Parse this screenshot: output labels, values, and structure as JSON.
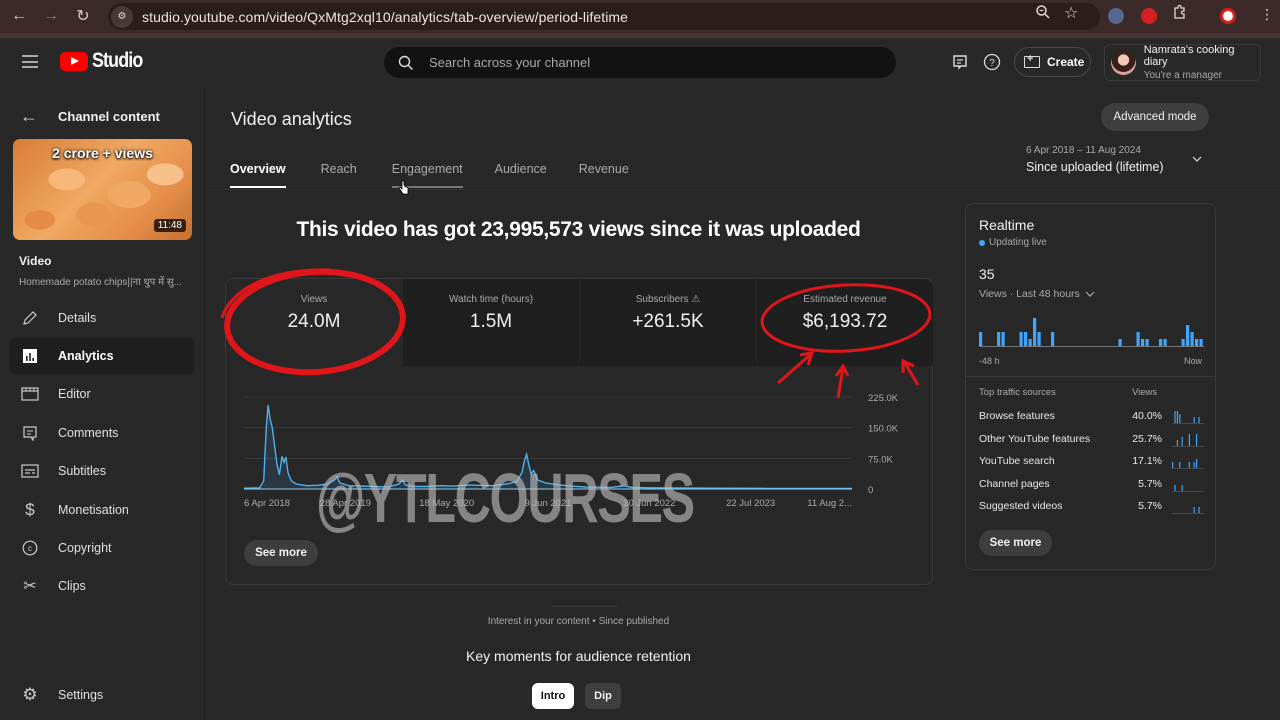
{
  "browser": {
    "url": "studio.youtube.com/video/QxMtg2xql10/analytics/tab-overview/period-lifetime",
    "icons": [
      "back-icon",
      "forward-icon",
      "reload-icon",
      "site-info-icon",
      "zoom-icon",
      "bookmark-star-icon",
      "extension-cursor-icon",
      "extension-hand-icon",
      "extensions-puzzle-icon",
      "profile-icon",
      "menu-dots-icon"
    ]
  },
  "header": {
    "logo_text": "Studio",
    "search_placeholder": "Search across your channel",
    "create_label": "Create",
    "account_name": "Namrata's cooking diary",
    "account_role": "You're a manager"
  },
  "sidebar": {
    "back_label": "Channel content",
    "thumbnail_caption": "2 crore + views",
    "thumbnail_duration": "11:48",
    "video_label": "Video",
    "video_title": "Homemade potato chips||ना धुप में सु...",
    "items": [
      {
        "label": "Details",
        "icon": "pencil-icon",
        "active": false
      },
      {
        "label": "Analytics",
        "icon": "analytics-icon",
        "active": true
      },
      {
        "label": "Editor",
        "icon": "editor-clapper-icon",
        "active": false
      },
      {
        "label": "Comments",
        "icon": "comments-icon",
        "active": false
      },
      {
        "label": "Subtitles",
        "icon": "subtitles-icon",
        "active": false
      },
      {
        "label": "Monetisation",
        "icon": "dollar-icon",
        "active": false
      },
      {
        "label": "Copyright",
        "icon": "copyright-icon",
        "active": false
      },
      {
        "label": "Clips",
        "icon": "scissors-icon",
        "active": false
      }
    ],
    "settings_label": "Settings"
  },
  "main": {
    "title": "Video analytics",
    "advanced_mode_label": "Advanced mode",
    "tabs": [
      {
        "label": "Overview",
        "active": true
      },
      {
        "label": "Reach",
        "active": false
      },
      {
        "label": "Engagement",
        "active": false,
        "hover": true
      },
      {
        "label": "Audience",
        "active": false
      },
      {
        "label": "Revenue",
        "active": false
      }
    ],
    "date_range": "6 Apr 2018 – 11 Aug 2024",
    "period_label": "Since uploaded (lifetime)",
    "headline": "This video has got 23,995,573 views since it was uploaded",
    "metrics": [
      {
        "label": "Views",
        "value": "24.0M"
      },
      {
        "label": "Watch time (hours)",
        "value": "1.5M"
      },
      {
        "label": "Subscribers",
        "value": "+261.5K",
        "warning": true
      },
      {
        "label": "Estimated revenue",
        "value": "$6,193.72"
      }
    ],
    "see_more_label": "See more",
    "interest_text": "Interest in your content • Since published",
    "key_moments_title": "Key moments for audience retention",
    "chips": [
      {
        "label": "Intro",
        "selected": true
      },
      {
        "label": "Dip",
        "selected": false
      }
    ]
  },
  "realtime": {
    "title": "Realtime",
    "status": "Updating live",
    "count": "35",
    "metric_label": "Views · Last 48 hours",
    "axis_start": "-48 h",
    "axis_end": "Now",
    "bars": [
      2,
      0,
      0,
      0,
      2,
      2,
      0,
      0,
      0,
      2,
      2,
      1,
      4,
      2,
      0,
      0,
      2,
      0,
      0,
      0,
      0,
      0,
      0,
      0,
      0,
      0,
      0,
      0,
      0,
      0,
      0,
      1,
      0,
      0,
      0,
      2,
      1,
      1,
      0,
      0,
      1,
      1,
      0,
      0,
      0,
      1,
      3,
      2,
      1,
      1
    ],
    "traffic_header": "Top traffic sources",
    "traffic_views_header": "Views",
    "traffic_sources": [
      {
        "name": "Browse features",
        "pct": "40.0%",
        "spark": [
          0,
          4,
          4,
          3,
          0,
          0,
          0,
          0,
          0,
          2,
          0,
          2,
          0
        ]
      },
      {
        "name": "Other YouTube features",
        "pct": "25.7%",
        "spark": [
          0,
          0,
          2,
          0,
          3,
          0,
          0,
          4,
          0,
          0,
          4,
          0,
          0
        ]
      },
      {
        "name": "YouTube search",
        "pct": "17.1%",
        "spark": [
          2,
          0,
          0,
          2,
          0,
          0,
          0,
          2,
          0,
          2,
          3,
          0,
          0
        ]
      },
      {
        "name": "Channel pages",
        "pct": "5.7%",
        "spark": [
          0,
          2,
          0,
          0,
          2,
          0,
          0,
          0,
          0,
          0,
          0,
          0,
          0
        ]
      },
      {
        "name": "Suggested videos",
        "pct": "5.7%",
        "spark": [
          0,
          0,
          0,
          0,
          0,
          0,
          0,
          0,
          0,
          2,
          0,
          2,
          0
        ]
      }
    ],
    "see_more_label": "See more"
  },
  "chart_data": {
    "type": "line",
    "title": "",
    "xlabel": "",
    "ylabel": "Views",
    "ylim": [
      0,
      225000
    ],
    "yticks": [
      "0",
      "75.0K",
      "150.0K",
      "225.0K"
    ],
    "ytick_values": [
      0,
      75000,
      150000,
      225000
    ],
    "xtick_labels": [
      "6 Apr 2018",
      "28 Apr 2019",
      "18 May 2020",
      "9 Jun 2021",
      "30 Jun 2022",
      "22 Jul 2023",
      "11 Aug 2..."
    ],
    "x_range_days": [
      0,
      2319
    ],
    "series": [
      {
        "name": "Views",
        "color": "#3ea6ff",
        "points": [
          [
            0,
            2000
          ],
          [
            60,
            3000
          ],
          [
            75,
            20000
          ],
          [
            85,
            150000
          ],
          [
            92,
            205000
          ],
          [
            100,
            170000
          ],
          [
            108,
            150000
          ],
          [
            118,
            100000
          ],
          [
            126,
            60000
          ],
          [
            135,
            35000
          ],
          [
            145,
            80000
          ],
          [
            152,
            65000
          ],
          [
            160,
            78000
          ],
          [
            168,
            40000
          ],
          [
            180,
            20000
          ],
          [
            200,
            12000
          ],
          [
            240,
            8000
          ],
          [
            280,
            9000
          ],
          [
            320,
            12000
          ],
          [
            345,
            22000
          ],
          [
            355,
            30000
          ],
          [
            365,
            15000
          ],
          [
            400,
            8000
          ],
          [
            450,
            7000
          ],
          [
            500,
            6000
          ],
          [
            550,
            5000
          ],
          [
            590,
            12000
          ],
          [
            605,
            22000
          ],
          [
            615,
            10000
          ],
          [
            650,
            6000
          ],
          [
            700,
            6000
          ],
          [
            750,
            8000
          ],
          [
            800,
            7000
          ],
          [
            850,
            10000
          ],
          [
            900,
            9000
          ],
          [
            950,
            8000
          ],
          [
            1000,
            12000
          ],
          [
            1040,
            18000
          ],
          [
            1060,
            40000
          ],
          [
            1070,
            70000
          ],
          [
            1078,
            85000
          ],
          [
            1086,
            60000
          ],
          [
            1095,
            38000
          ],
          [
            1105,
            45000
          ],
          [
            1120,
            22000
          ],
          [
            1150,
            15000
          ],
          [
            1200,
            10000
          ],
          [
            1250,
            7000
          ],
          [
            1300,
            5000
          ],
          [
            1400,
            4000
          ],
          [
            1450,
            8000
          ],
          [
            1480,
            4000
          ],
          [
            1550,
            3000
          ],
          [
            1650,
            2500
          ],
          [
            1800,
            2000
          ],
          [
            2000,
            1500
          ],
          [
            2319,
            1500
          ]
        ]
      }
    ]
  },
  "annotations": {
    "watermark": "@YTLCOURSES"
  }
}
